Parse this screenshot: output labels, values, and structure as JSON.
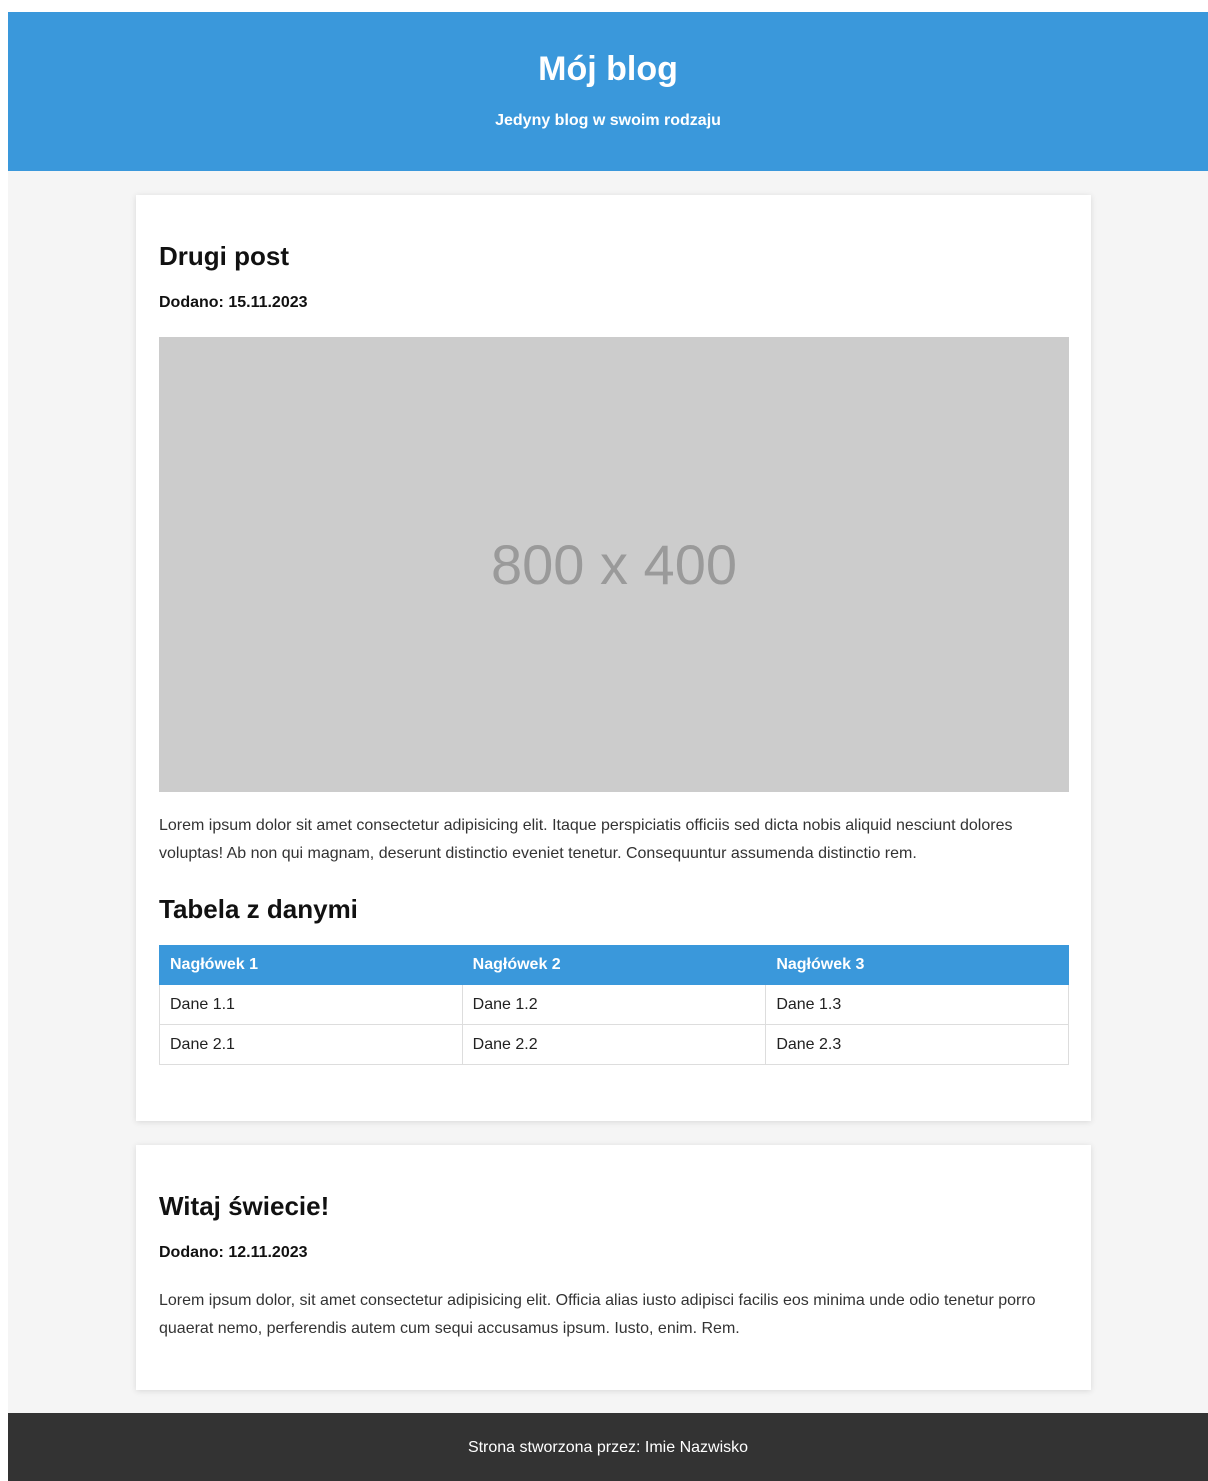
{
  "header": {
    "title": "Mój blog",
    "subtitle": "Jedyny blog w swoim rodzaju",
    "background": "#3a98db"
  },
  "posts": [
    {
      "title": "Drugi post",
      "date_label": "Dodano: 15.11.2023",
      "image_placeholder": "800 x 400",
      "body": "Lorem ipsum dolor sit amet consectetur adipisicing elit. Itaque perspiciatis officiis sed dicta nobis aliquid nesciunt dolores voluptas! Ab non qui magnam, deserunt distinctio eveniet tenetur. Consequuntur assumenda distinctio rem.",
      "table": {
        "title": "Tabela z danymi",
        "headers": [
          "Nagłówek 1",
          "Nagłówek 2",
          "Nagłówek 3"
        ],
        "rows": [
          [
            "Dane 1.1",
            "Dane 1.2",
            "Dane 1.3"
          ],
          [
            "Dane 2.1",
            "Dane 2.2",
            "Dane 2.3"
          ]
        ]
      }
    },
    {
      "title": "Witaj świecie!",
      "date_label": "Dodano: 12.11.2023",
      "body": "Lorem ipsum dolor, sit amet consectetur adipisicing elit. Officia alias iusto adipisci facilis eos minima unde odio tenetur porro quaerat nemo, perferendis autem cum sequi accusamus ipsum. Iusto, enim. Rem."
    }
  ],
  "footer": {
    "text": "Strona stworzona przez: Imie Nazwisko",
    "background": "#333333"
  }
}
